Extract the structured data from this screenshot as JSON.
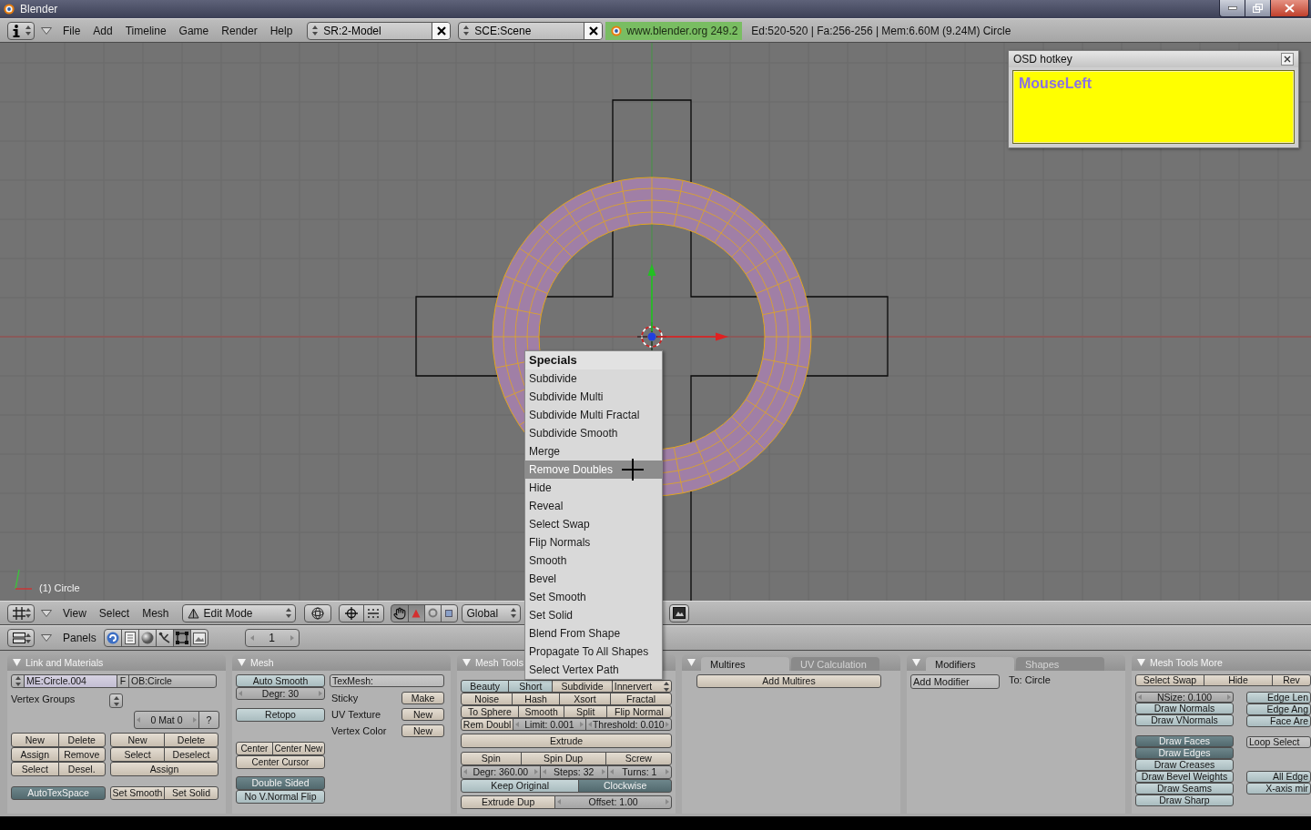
{
  "window": {
    "title": "Blender"
  },
  "top_header": {
    "menus": [
      "File",
      "Add",
      "Timeline",
      "Game",
      "Render",
      "Help"
    ],
    "screen": "SR:2-Model",
    "scene": "SCE:Scene",
    "version": "www.blender.org 249.2",
    "stats": "Ed:520-520 | Fa:256-256 | Mem:6.60M (9.24M) Circle"
  },
  "viewport": {
    "object_label": "(1) Circle"
  },
  "osd_hotkey": {
    "title": "OSD hotkey",
    "key": "MouseLeft"
  },
  "specials_menu": {
    "title": "Specials",
    "items": [
      {
        "label": "Subdivide",
        "selected": false
      },
      {
        "label": "Subdivide Multi",
        "selected": false
      },
      {
        "label": "Subdivide Multi Fractal",
        "selected": false
      },
      {
        "label": "Subdivide Smooth",
        "selected": false
      },
      {
        "label": "Merge",
        "selected": false
      },
      {
        "label": "Remove Doubles",
        "selected": true
      },
      {
        "label": "Hide",
        "selected": false
      },
      {
        "label": "Reveal",
        "selected": false
      },
      {
        "label": "Select Swap",
        "selected": false
      },
      {
        "label": "Flip Normals",
        "selected": false
      },
      {
        "label": "Smooth",
        "selected": false
      },
      {
        "label": "Bevel",
        "selected": false
      },
      {
        "label": "Set Smooth",
        "selected": false
      },
      {
        "label": "Set Solid",
        "selected": false
      },
      {
        "label": "Blend From Shape",
        "selected": false
      },
      {
        "label": "Propagate To All Shapes",
        "selected": false
      },
      {
        "label": "Select Vertex Path",
        "selected": false
      }
    ]
  },
  "viewport_header": {
    "menus": [
      "View",
      "Select",
      "Mesh"
    ],
    "mode": "Edit Mode",
    "manipulator": {
      "on": true,
      "modes": [
        {
          "on": true
        },
        {
          "on": false
        },
        {
          "on": false
        }
      ]
    },
    "orientation": "Global"
  },
  "buttons_header": {
    "label": "Panels",
    "contexts": [
      {
        "selected": false
      },
      {
        "selected": false
      },
      {
        "selected": false
      },
      {
        "selected": false
      },
      {
        "selected": true
      },
      {
        "selected": false
      }
    ],
    "frame": "1"
  },
  "panels": [
    {
      "kind": "link_materials",
      "title": "Link and Materials",
      "mesh_name": "ME:Circle.004",
      "fake_user": "F",
      "object_name": "OB:Circle",
      "vertex_groups": "Vertex Groups",
      "material_slot": "0 Mat 0",
      "material_help": "?",
      "group_buttons": [
        [
          "New",
          "Delete"
        ],
        [
          "Assign",
          "Remove"
        ],
        [
          "Select",
          "Desel."
        ]
      ],
      "material_buttons": [
        [
          "New",
          "Delete"
        ],
        [
          "Select",
          "Deselect"
        ],
        [
          "Assign"
        ]
      ],
      "auto_tex_space": {
        "label": "AutoTexSpace",
        "on": true
      },
      "shading_buttons": [
        "Set Smooth",
        "Set Solid"
      ]
    },
    {
      "kind": "mesh",
      "title": "Mesh",
      "auto_smooth": {
        "label": "Auto Smooth",
        "on": false
      },
      "smooth_degrees": "Degr: 30",
      "retopo": {
        "label": "Retopo",
        "on": false
      },
      "center_buttons": [
        [
          "Center",
          "Center New"
        ],
        [
          "Center Cursor"
        ]
      ],
      "double_sided": {
        "label": "Double Sided",
        "on": true
      },
      "no_normal_flip": {
        "label": "No V.Normal Flip",
        "on": false
      },
      "tex_mesh": "TexMesh:",
      "layers": [
        {
          "label": "Sticky",
          "action": "Make"
        },
        {
          "label": "UV Texture",
          "action": "New"
        },
        {
          "label": "Vertex Color",
          "action": "New"
        }
      ]
    },
    {
      "kind": "mesh_tools",
      "title": "Mesh Tools",
      "groups": [
        [
          [
            {
              "kind": "toggle",
              "label": "Beauty",
              "on": false
            },
            {
              "kind": "toggle",
              "label": "Short",
              "on": false
            },
            {
              "kind": "button",
              "label": "Subdivide"
            },
            {
              "kind": "menu",
              "label": "Innervert"
            }
          ],
          [
            {
              "kind": "button",
              "label": "Noise"
            },
            {
              "kind": "button",
              "label": "Hash"
            },
            {
              "kind": "button",
              "label": "Xsort"
            },
            {
              "kind": "button",
              "label": "Fractal"
            }
          ],
          [
            {
              "kind": "button",
              "label": "To Sphere"
            },
            {
              "kind": "button",
              "label": "Smooth"
            },
            {
              "kind": "button",
              "label": "Split"
            },
            {
              "kind": "button",
              "label": "Flip Normal"
            }
          ],
          [
            {
              "kind": "button",
              "label": "Rem Doubl"
            },
            {
              "kind": "number",
              "label": "Limit: 0.001"
            },
            {
              "kind": "number",
              "label": "Threshold: 0.010"
            }
          ]
        ],
        [
          [
            {
              "kind": "button",
              "label": "Extrude"
            }
          ]
        ],
        [
          [
            {
              "kind": "button",
              "label": "Spin"
            },
            {
              "kind": "button",
              "label": "Spin Dup"
            },
            {
              "kind": "button",
              "label": "Screw"
            }
          ],
          [
            {
              "kind": "number",
              "label": "Degr: 360.00"
            },
            {
              "kind": "number",
              "label": "Steps: 32"
            },
            {
              "kind": "number",
              "label": "Turns: 1"
            }
          ],
          [
            {
              "kind": "toggle",
              "label": "Keep Original",
              "on": false
            },
            {
              "kind": "toggle",
              "label": "Clockwise",
              "on": true
            }
          ]
        ],
        [
          [
            {
              "kind": "button",
              "label": "Extrude Dup"
            },
            {
              "kind": "number",
              "label": "Offset: 1.00"
            }
          ]
        ]
      ]
    },
    {
      "kind": "multires",
      "tabs": [
        {
          "label": "Multires",
          "selected": true
        },
        {
          "label": "UV Calculation",
          "selected": false
        }
      ],
      "button": "Add Multires"
    },
    {
      "kind": "modifiers",
      "tabs": [
        {
          "label": "Modifiers",
          "selected": true
        },
        {
          "label": "Shapes",
          "selected": false
        }
      ],
      "add_menu": "Add Modifier",
      "target": "To: Circle"
    },
    {
      "kind": "mesh_tools_more",
      "title": "Mesh Tools More",
      "top_row": [
        "Select Swap",
        "Hide",
        "Rev"
      ],
      "normal_size": "NSize: 0.100",
      "normal_toggles": [
        {
          "label": "Draw Normals",
          "on": false
        },
        {
          "label": "Draw VNormals",
          "on": false
        }
      ],
      "draw_toggles": [
        {
          "label": "Draw Faces",
          "on": true
        },
        {
          "label": "Draw Edges",
          "on": true
        },
        {
          "label": "Draw Creases",
          "on": false
        },
        {
          "label": "Draw Bevel Weights",
          "on": false
        },
        {
          "label": "Draw Seams",
          "on": false
        },
        {
          "label": "Draw Sharp",
          "on": false
        }
      ],
      "measure_toggles": [
        {
          "label": "Edge Len",
          "on": false
        },
        {
          "label": "Edge Ang",
          "on": false
        },
        {
          "label": "Face Are",
          "on": false
        }
      ],
      "loop_select": "Loop Select",
      "edge_toggles": [
        {
          "label": "All Edge",
          "on": false
        },
        {
          "label": "X-axis mir",
          "on": false
        }
      ]
    }
  ]
}
